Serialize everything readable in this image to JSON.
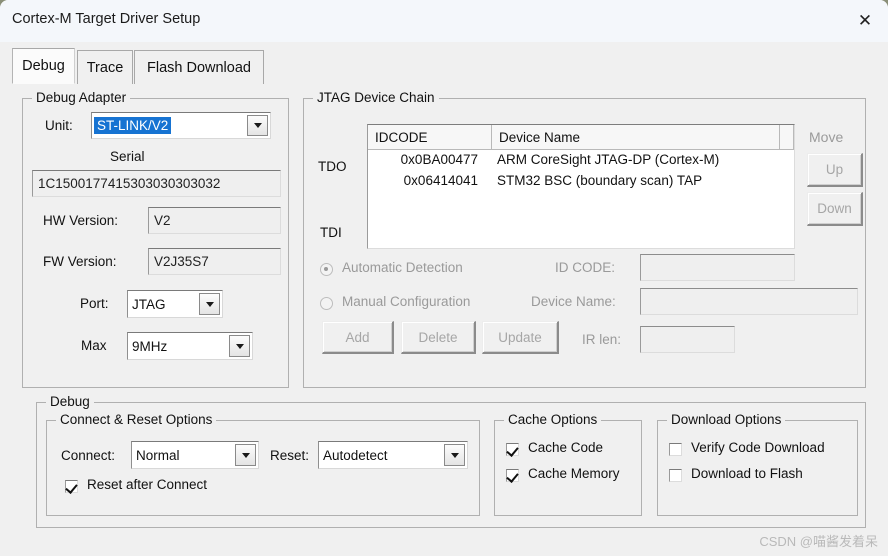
{
  "window": {
    "title": "Cortex-M Target Driver Setup",
    "close_icon": "close-icon"
  },
  "tabs": [
    {
      "label": "Debug",
      "active": true
    },
    {
      "label": "Trace",
      "active": false
    },
    {
      "label": "Flash Download",
      "active": false
    }
  ],
  "debug_adapter": {
    "legend": "Debug Adapter",
    "unit_label": "Unit:",
    "unit_value": "ST-LINK/V2",
    "serial_label": "Serial",
    "serial_value": "1C1500177415303030303032",
    "hw_version_label": "HW Version:",
    "hw_version_value": "V2",
    "fw_version_label": "FW Version:",
    "fw_version_value": "V2J35S7",
    "port_label": "Port:",
    "port_value": "JTAG",
    "max_label": "Max",
    "max_value": "9MHz"
  },
  "jtag_chain": {
    "legend": "JTAG Device Chain",
    "tdo_label": "TDO",
    "tdi_label": "TDI",
    "columns": [
      "IDCODE",
      "Device Name",
      ""
    ],
    "rows": [
      {
        "idcode": "0x0BA00477",
        "device_name": "ARM CoreSight JTAG-DP (Cortex-M)"
      },
      {
        "idcode": "0x06414041",
        "device_name": "STM32 BSC (boundary scan) TAP"
      }
    ],
    "move_label": "Move",
    "up_label": "Up",
    "down_label": "Down",
    "automatic_detection_label": "Automatic Detection",
    "manual_configuration_label": "Manual Configuration",
    "selected_mode": "automatic",
    "add_label": "Add",
    "delete_label": "Delete",
    "update_label": "Update",
    "id_code_label": "ID CODE:",
    "id_code_value": "",
    "device_name_label": "Device Name:",
    "device_name_value": "",
    "ir_len_label": "IR len:",
    "ir_len_value": ""
  },
  "debug": {
    "legend": "Debug",
    "connect_reset": {
      "legend": "Connect & Reset Options",
      "connect_label": "Connect:",
      "connect_value": "Normal",
      "reset_label": "Reset:",
      "reset_value": "Autodetect",
      "reset_after_connect_label": "Reset after Connect",
      "reset_after_connect_checked": true
    },
    "cache_options": {
      "legend": "Cache Options",
      "cache_code_label": "Cache Code",
      "cache_code_checked": true,
      "cache_memory_label": "Cache Memory",
      "cache_memory_checked": true
    },
    "download_options": {
      "legend": "Download Options",
      "verify_code_download_label": "Verify Code Download",
      "verify_code_download_checked": false,
      "download_to_flash_label": "Download to Flash",
      "download_to_flash_checked": false
    }
  },
  "watermark": "CSDN @喵酱发着呆",
  "colors": {
    "accent": "#1673d2",
    "window_bg": "#f0f0f0",
    "titlebar_bg": "#f4f7fb",
    "desktop_bg": "#8a8f78"
  }
}
